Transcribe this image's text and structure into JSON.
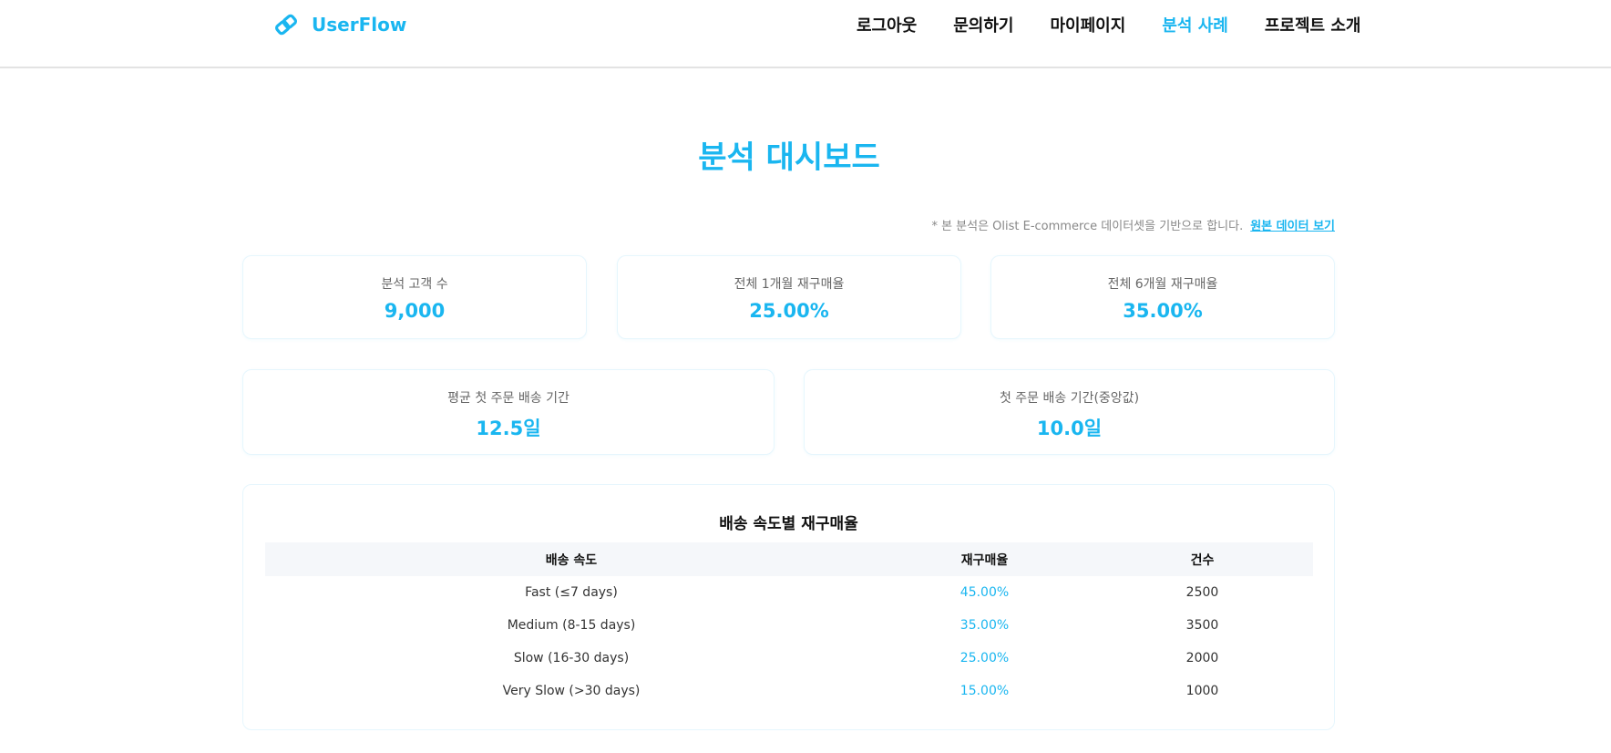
{
  "header": {
    "brand": "UserFlow",
    "nav": [
      {
        "label": "로그아웃"
      },
      {
        "label": "문의하기"
      },
      {
        "label": "마이페이지"
      },
      {
        "label": "분석 사례"
      },
      {
        "label": "프로젝트 소개"
      }
    ],
    "active_index": 3
  },
  "page": {
    "title": "분석 대시보드",
    "note": "* 본 분석은 Olist E-commerce 데이터셋을 기반으로 합니다.",
    "note_link": "원본 데이터 보기"
  },
  "stats": [
    {
      "label": "분석 고객 수",
      "value": "9,000"
    },
    {
      "label": "전체 1개월 재구매율",
      "value": "25.00%"
    },
    {
      "label": "전체 6개월 재구매율",
      "value": "35.00%"
    },
    {
      "label": "평균 첫 주문 배송 기간",
      "value": "12.5일"
    },
    {
      "label": "첫 주문 배송 기간(중앙값)",
      "value": "10.0일"
    }
  ],
  "table": {
    "title": "배송 속도별 재구매율",
    "headers": [
      "배송 속도",
      "재구매율",
      "건수"
    ],
    "rows": [
      [
        "Fast (≤7 days)",
        "45.00%",
        "2500"
      ],
      [
        "Medium (8-15 days)",
        "35.00%",
        "3500"
      ],
      [
        "Slow (16-30 days)",
        "25.00%",
        "2000"
      ],
      [
        "Very Slow (>30 days)",
        "15.00%",
        "1000"
      ]
    ]
  },
  "colors": {
    "accent": "#1ab6f0",
    "text": "#111111",
    "muted": "#888888"
  },
  "icons": {
    "logo": "link-icon"
  }
}
